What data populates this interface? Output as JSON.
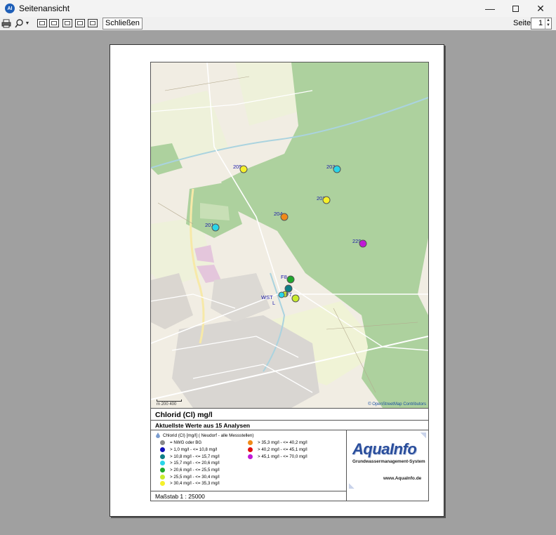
{
  "window": {
    "title": "Seitenansicht",
    "icon": "aquainfo-app-icon"
  },
  "toolbar": {
    "close_label": "Schließen",
    "page_label": "Seite",
    "page_value": "1"
  },
  "map": {
    "scale_text": "m  200  400",
    "credit": "© OpenStreetMap Contributors",
    "markers": [
      {
        "label": "205",
        "color": "#f5f02a"
      },
      {
        "label": "203",
        "color": "#2ad5e8"
      },
      {
        "label": "202",
        "color": "#f5f02a"
      },
      {
        "label": "204",
        "color": "#f08a18"
      },
      {
        "label": "201",
        "color": "#2ad5e8"
      },
      {
        "label": "229",
        "color": "#c019d6"
      },
      {
        "label": "F8",
        "color": "#1fa92c"
      },
      {
        "label": "WST",
        "color": "#0e7e86"
      },
      {
        "label": "F7",
        "color": "#c9ec2c"
      },
      {
        "label": "L",
        "color": "#2ad5e8"
      }
    ]
  },
  "report": {
    "title": "Chlorid (Cl) mg/l",
    "subtitle": "Aktuellste Werte aus 15 Analysen",
    "legend_header": "Chlorid (Cl) [mg/l] ( Neudorf - alle Messstellen)",
    "legend_col1": [
      {
        "label": "= NWG oder BG",
        "color": "#8a8a8a"
      },
      {
        "label": "> 1,0 mg/l - <= 10,8 mg/l",
        "color": "#1010b8"
      },
      {
        "label": "> 10,8 mg/l - <= 15,7 mg/l",
        "color": "#0e7e86"
      },
      {
        "label": "> 15,7 mg/l - <= 20,6 mg/l",
        "color": "#2ad5e8"
      },
      {
        "label": "> 20,6 mg/l - <= 25,5 mg/l",
        "color": "#1fa92c"
      },
      {
        "label": "> 25,5 mg/l - <= 30,4 mg/l",
        "color": "#c9ec2c"
      },
      {
        "label": "> 30,4 mg/l - <= 35,3 mg/l",
        "color": "#f5f02a"
      }
    ],
    "legend_col2": [
      {
        "label": "> 35,3 mg/l - <= 40,2 mg/l",
        "color": "#f08a18"
      },
      {
        "label": "> 40,2 mg/l - <= 45,1 mg/l",
        "color": "#e01010"
      },
      {
        "label": "> 45,1 mg/l - <= 70,0 mg/l",
        "color": "#c019d6"
      }
    ],
    "logo": "AquaInfo",
    "logo_sub": "Grundwassermanagement-System",
    "logo_url": "www.AquaInfo.de",
    "scale": "Maßstab 1 : 25000"
  }
}
